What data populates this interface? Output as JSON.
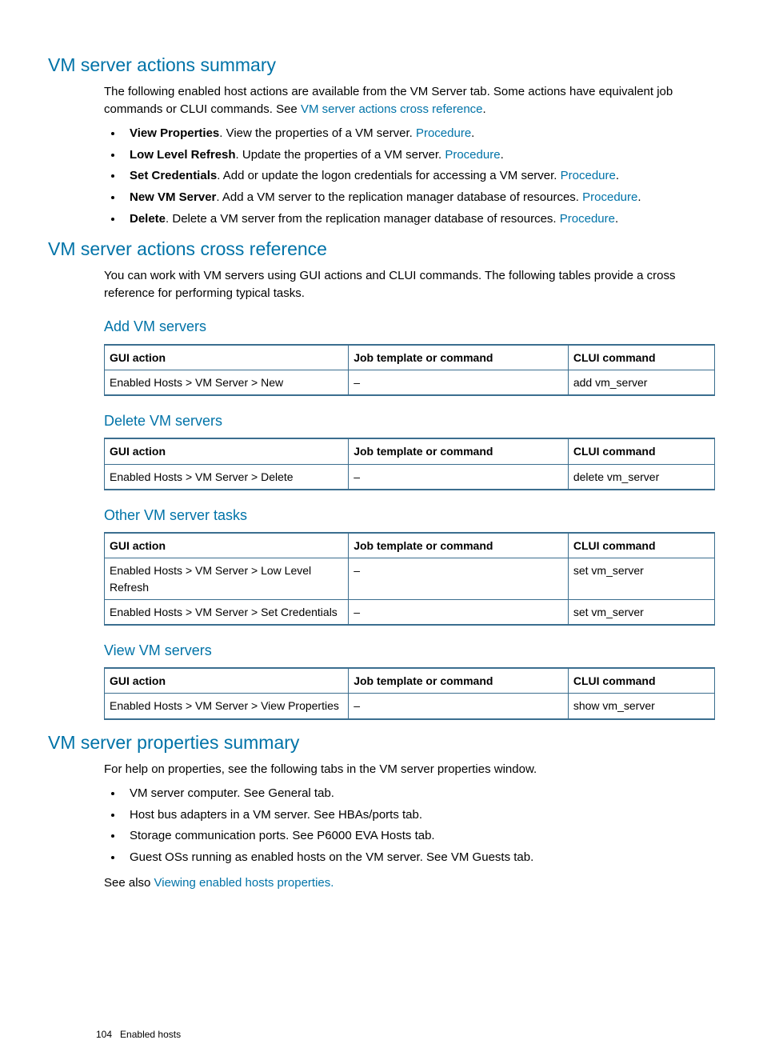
{
  "sections": {
    "summary": {
      "heading": "VM server actions summary",
      "intro_pre": "The following enabled host actions are available from the VM Server tab. Some actions have equivalent job commands or CLUI commands. See ",
      "intro_link": "VM server actions cross reference",
      "intro_post": ".",
      "bullets": [
        {
          "bold": "View Properties",
          "text": ". View the properties of a VM server. ",
          "link": "Procedure",
          "post": "."
        },
        {
          "bold": "Low Level Refresh",
          "text": ". Update the properties of a VM server. ",
          "link": "Procedure",
          "post": "."
        },
        {
          "bold": "Set Credentials",
          "text": ". Add or update the logon credentials for accessing a VM server. ",
          "link": "Procedure",
          "post": "."
        },
        {
          "bold": "New VM Server",
          "text": ". Add a VM server to the replication manager database of resources. ",
          "link": "Procedure",
          "post": "."
        },
        {
          "bold": "Delete",
          "text": ". Delete a VM server from the replication manager database of resources. ",
          "link": "Procedure",
          "post": "."
        }
      ]
    },
    "crossref": {
      "heading": "VM server actions cross reference",
      "intro": "You can work with VM servers using GUI actions and CLUI commands. The following tables provide a cross reference for performing typical tasks.",
      "table_headers": {
        "gui": "GUI action",
        "job": "Job template or command",
        "clui": "CLUI command"
      },
      "tables": [
        {
          "title": "Add VM servers",
          "rows": [
            {
              "gui": "Enabled Hosts > VM Server > New",
              "job": "–",
              "clui": "add vm_server"
            }
          ]
        },
        {
          "title": "Delete VM servers",
          "rows": [
            {
              "gui": "Enabled Hosts > VM Server > Delete",
              "job": "–",
              "clui": "delete vm_server"
            }
          ]
        },
        {
          "title": "Other VM server tasks",
          "rows": [
            {
              "gui": "Enabled Hosts > VM Server > Low Level Refresh",
              "job": "–",
              "clui": "set vm_server"
            },
            {
              "gui": "Enabled Hosts > VM Server > Set Credentials",
              "job": "–",
              "clui": "set vm_server"
            }
          ]
        },
        {
          "title": "View VM servers",
          "rows": [
            {
              "gui": "Enabled Hosts > VM Server > View Properties",
              "job": "–",
              "clui": "show vm_server"
            }
          ]
        }
      ]
    },
    "props": {
      "heading": "VM server properties summary",
      "intro": "For help on properties, see the following tabs in the VM server properties window.",
      "bullets": [
        "VM server computer. See General tab.",
        "Host bus adapters in a VM server. See HBAs/ports tab.",
        "Storage communication ports. See P6000 EVA Hosts tab.",
        "Guest OSs running as enabled hosts on the VM server. See VM Guests tab."
      ],
      "seealso_pre": "See also ",
      "seealso_link": "Viewing enabled hosts properties.",
      "seealso_post": ""
    }
  },
  "footer": {
    "page": "104",
    "label": "Enabled hosts"
  }
}
